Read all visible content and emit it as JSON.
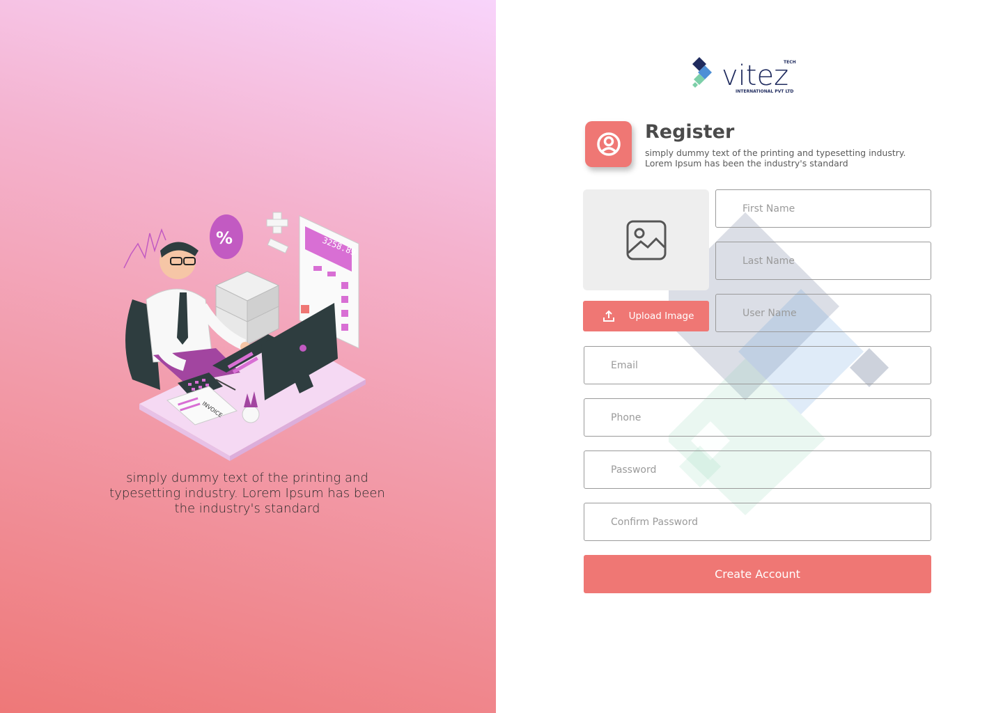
{
  "left": {
    "caption": "simply dummy text of the printing and typesetting industry. Lorem Ipsum has been the industry's standard",
    "calculator_display": "3258.89",
    "invoice_label": "INVOICE"
  },
  "brand": {
    "name": "vitez",
    "tag": "TECH",
    "subtitle": "INTERNATIONAL PVT LTD"
  },
  "register": {
    "title": "Register",
    "subtitle": "simply dummy text of the printing and typesetting industry. Lorem Ipsum has been the industry's standard"
  },
  "upload": {
    "label": "Upload Image"
  },
  "form": {
    "first_name": "First Name",
    "last_name": "Last Name",
    "user_name": "User Name",
    "email": "Email",
    "phone": "Phone",
    "password": "Password",
    "confirm_password": "Confirm Password"
  },
  "submit": {
    "label": "Create Account"
  },
  "colors": {
    "accent": "#ef7774",
    "placeholder_bg": "#eeeeee"
  },
  "icons": [
    "user-circle-icon",
    "image-icon",
    "upload-icon"
  ]
}
